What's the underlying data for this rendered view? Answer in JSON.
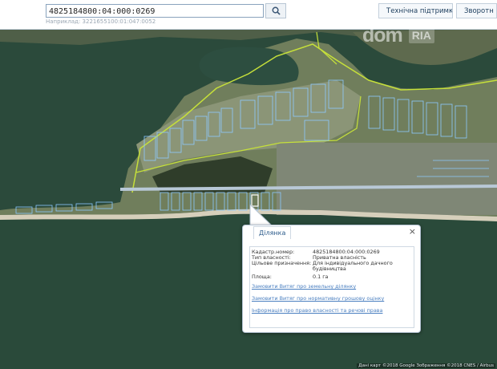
{
  "search": {
    "value": "4825184800:04:000:0269",
    "example": "Наприклад: 3221655100:01:047:0052"
  },
  "toolbar": {
    "support_label": "Технічна підтримка",
    "feedback_label": "Зворотн"
  },
  "logo": {
    "dom": "dom",
    "ria": "RIA"
  },
  "popup": {
    "tab_label": "Ділянка",
    "properties": [
      {
        "key": "Кадастр.номер:",
        "value": "4825184800:04:000:0269"
      },
      {
        "key": "Тип власності:",
        "value": "Приватна власність"
      },
      {
        "key": "Цільове призначення:",
        "value": "Для індивідуального дачного будівництва"
      },
      {
        "key": "Площа:",
        "value": "0.1 га"
      }
    ],
    "links": [
      "Замовити Витяг про земельну ділянку",
      "Замовити Витяг про нормативну грошову оцінку",
      "Інформація про право власності та речові права"
    ],
    "close_symbol": "×"
  },
  "attribution": "Дані карт ©2018 Google Зображення ©2018 CNES / Airbus",
  "colors": {
    "water": "#274539",
    "land": "#6b7a5a",
    "parcel_outline": "#8cc8ff",
    "boundary": "#c8e83c",
    "beach": "#d8d2bf",
    "accent": "#2a5a8a"
  }
}
